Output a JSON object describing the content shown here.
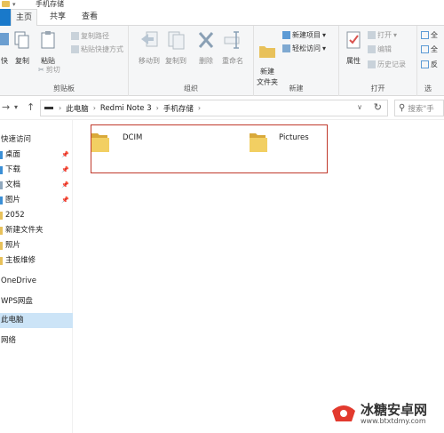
{
  "window": {
    "title": "手机存储"
  },
  "ribbon_tabs": [
    {
      "label": "主页",
      "active": true
    },
    {
      "label": "共享",
      "active": false
    },
    {
      "label": "查看",
      "active": false
    }
  ],
  "clipboard": {
    "label": "剪贴板",
    "pin_partial": "快",
    "copy": "复制",
    "paste": "粘贴",
    "copy_path": "复制路径",
    "paste_shortcut": "粘贴快捷方式",
    "cut": "剪切"
  },
  "organize": {
    "label": "组织",
    "move_to": "移动到",
    "copy_to": "复制到",
    "delete": "删除",
    "rename": "重命名"
  },
  "new_group": {
    "label": "新建",
    "new_folder": "新建\n文件夹",
    "new_item": "新建项目",
    "easy_access": "轻松访问"
  },
  "open_group": {
    "label": "打开",
    "properties": "属性",
    "open": "打开",
    "edit": "编辑",
    "history": "历史记录"
  },
  "select_group": {
    "label_partial": "选",
    "select_all": "全",
    "select_none": "全",
    "invert": "反"
  },
  "address": {
    "segments": [
      "此电脑",
      "Redmi Note 3",
      "手机存储"
    ],
    "search_placeholder": "搜索\"手"
  },
  "nav": {
    "quick_access": "快速访问",
    "items": [
      {
        "label": "桌面",
        "pinned": true,
        "color": "#3b8fd6"
      },
      {
        "label": "下载",
        "pinned": true,
        "color": "#3b8fd6"
      },
      {
        "label": "文档",
        "pinned": true,
        "color": "#8fa7bd"
      },
      {
        "label": "图片",
        "pinned": true,
        "color": "#3b8fd6"
      },
      {
        "label": "2052",
        "pinned": false,
        "color": "#e8c15a"
      },
      {
        "label": "新建文件夹",
        "pinned": false,
        "color": "#e8c15a"
      },
      {
        "label": "照片",
        "pinned": false,
        "color": "#e8c15a"
      },
      {
        "label": "主板维修",
        "pinned": false,
        "color": "#e8c15a"
      }
    ],
    "onedrive": "OneDrive",
    "wps": "WPS网盘",
    "this_pc": "此电脑",
    "network": "网络"
  },
  "folders": [
    {
      "name": "DCIM"
    },
    {
      "name": "Pictures"
    }
  ],
  "watermark": {
    "title": "冰糖安卓网",
    "url": "www.btxtdmy.com"
  },
  "colors": {
    "accent": "#1979ca",
    "selection": "#cce4f7",
    "folder": "#e8c15a",
    "highlight_box": "#c0392b"
  }
}
